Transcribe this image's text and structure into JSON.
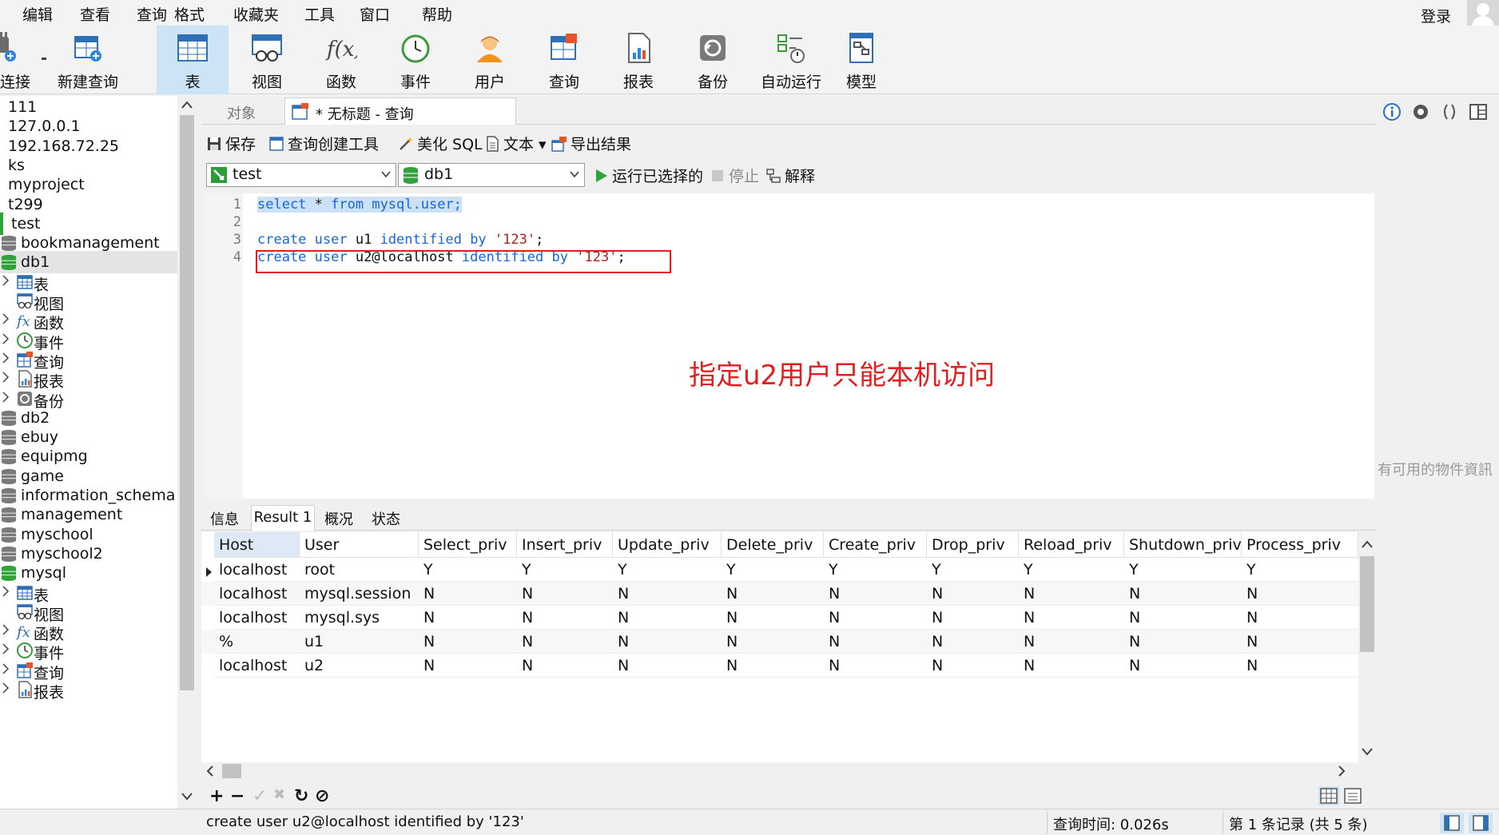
{
  "menu": [
    "编辑",
    "查看",
    "查询",
    "格式",
    "收藏夹",
    "工具",
    "窗口",
    "帮助"
  ],
  "login_label": "登录",
  "toolbar": {
    "connect": "连接",
    "new_query": "新建查询",
    "table": "表",
    "view": "视图",
    "function": "函数",
    "event": "事件",
    "user": "用户",
    "query": "查询",
    "report": "报表",
    "backup": "备份",
    "automation": "自动运行",
    "model": "模型"
  },
  "sidebar": {
    "connections": [
      "111",
      "127.0.0.1",
      "192.168.72.25",
      "ks",
      "myproject",
      "t299",
      "test"
    ],
    "databases_top": [
      "bookmanagement",
      "db1"
    ],
    "db1_children": [
      "表",
      "视图",
      "函数",
      "事件",
      "查询",
      "报表",
      "备份"
    ],
    "databases_mid": [
      "db2",
      "ebuy",
      "equipmg",
      "game",
      "information_schema",
      "management",
      "myschool",
      "myschool2",
      "mysql"
    ],
    "mysql_children": [
      "表",
      "视图",
      "函数",
      "事件",
      "查询",
      "报表"
    ]
  },
  "tabs": {
    "objects": "对象",
    "query_tab": "* 无标题 - 查询"
  },
  "query_toolbar": {
    "save": "保存",
    "builder": "查询创建工具",
    "beautify": "美化 SQL",
    "text": "文本",
    "export": "导出结果",
    "connection": "test",
    "database": "db1",
    "run_selected": "运行已选择的",
    "stop": "停止",
    "explain": "解释"
  },
  "editor": {
    "line_numbers": [
      "1",
      "2",
      "3",
      "4"
    ],
    "line1": {
      "kw1": "select",
      "rest": " * ",
      "kw2": "from",
      "tail": " mysql.user;"
    },
    "line3": {
      "kw1": "create",
      "sp1": " ",
      "kw2": "user",
      "mid": " u1 ",
      "kw3": "identified",
      "sp2": " ",
      "kw4": "by",
      "sp3": " ",
      "str": "'123'",
      "end": ";"
    },
    "line4": {
      "kw1": "create",
      "sp1": " ",
      "kw2": "user",
      "mid": " u2@localhost ",
      "kw3": "identified",
      "sp2": " ",
      "kw4": "by",
      "sp3": " ",
      "str": "'123'",
      "end": ";"
    }
  },
  "annotation": "指定u2用户只能本机访问",
  "right_panel_text": "有可用的物件資訊",
  "result_tabs": [
    "信息",
    "Result 1",
    "概况",
    "状态"
  ],
  "grid": {
    "columns": [
      "Host",
      "User",
      "Select_priv",
      "Insert_priv",
      "Update_priv",
      "Delete_priv",
      "Create_priv",
      "Drop_priv",
      "Reload_priv",
      "Shutdown_priv",
      "Process_priv"
    ],
    "rows": [
      [
        "localhost",
        "root",
        "Y",
        "Y",
        "Y",
        "Y",
        "Y",
        "Y",
        "Y",
        "Y",
        "Y"
      ],
      [
        "localhost",
        "mysql.session",
        "N",
        "N",
        "N",
        "N",
        "N",
        "N",
        "N",
        "N",
        "N"
      ],
      [
        "localhost",
        "mysql.sys",
        "N",
        "N",
        "N",
        "N",
        "N",
        "N",
        "N",
        "N",
        "N"
      ],
      [
        "%",
        "u1",
        "N",
        "N",
        "N",
        "N",
        "N",
        "N",
        "N",
        "N",
        "N"
      ],
      [
        "localhost",
        "u2",
        "N",
        "N",
        "N",
        "N",
        "N",
        "N",
        "N",
        "N",
        "N"
      ]
    ]
  },
  "grid_actions": {
    "add": "+",
    "remove": "−",
    "apply": "✓",
    "discard": "✖",
    "refresh": "↻",
    "stop": "⊘"
  },
  "status": {
    "sql": "create user u2@localhost identified by '123'",
    "query_time": "查询时间: 0.026s",
    "record": "第 1 条记录 (共 5 条)"
  },
  "colors": {
    "keyword": "#1565e0",
    "string": "#b42020",
    "annotation": "#e02020",
    "active_tab": "#cde4f7"
  }
}
